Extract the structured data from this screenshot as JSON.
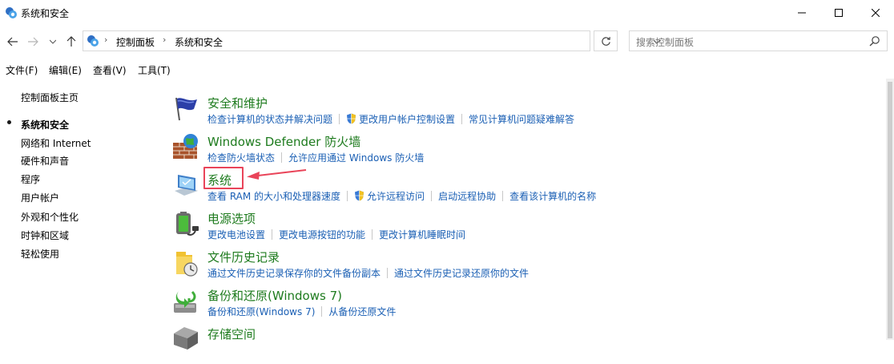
{
  "window": {
    "title": "系统和安全",
    "controls": [
      "minimize-icon",
      "maximize-icon",
      "close-icon"
    ]
  },
  "address": {
    "crumbs": [
      "控制面板",
      "系统和安全"
    ],
    "search_placeholder": "搜索控制面板"
  },
  "menu": [
    "文件(F)",
    "编辑(E)",
    "查看(V)",
    "工具(T)"
  ],
  "sidebar": {
    "items": [
      {
        "label": "控制面板主页",
        "current": false
      },
      {
        "label": "系统和安全",
        "current": true
      },
      {
        "label": "网络和 Internet",
        "current": false
      },
      {
        "label": "硬件和声音",
        "current": false
      },
      {
        "label": "程序",
        "current": false
      },
      {
        "label": "用户帐户",
        "current": false
      },
      {
        "label": "外观和个性化",
        "current": false
      },
      {
        "label": "时钟和区域",
        "current": false
      },
      {
        "label": "轻松使用",
        "current": false
      }
    ]
  },
  "categories": [
    {
      "title": "安全和维护",
      "icon": "security-flag-icon",
      "links": [
        {
          "label": "检查计算机的状态并解决问题",
          "shield": false
        },
        {
          "label": "更改用户帐户控制设置",
          "shield": true
        },
        {
          "label": "常见计算机问题疑难解答",
          "shield": false
        }
      ]
    },
    {
      "title": "Windows Defender 防火墙",
      "icon": "firewall-icon",
      "links": [
        {
          "label": "检查防火墙状态",
          "shield": false
        },
        {
          "label": "允许应用通过 Windows 防火墙",
          "shield": false
        }
      ]
    },
    {
      "title": "系统",
      "icon": "system-monitor-icon",
      "links": [
        {
          "label": "查看 RAM 的大小和处理器速度",
          "shield": false
        },
        {
          "label": "允许远程访问",
          "shield": true
        },
        {
          "label": "启动远程协助",
          "shield": false
        },
        {
          "label": "查看该计算机的名称",
          "shield": false
        }
      ]
    },
    {
      "title": "电源选项",
      "icon": "power-battery-icon",
      "links": [
        {
          "label": "更改电池设置",
          "shield": false
        },
        {
          "label": "更改电源按钮的功能",
          "shield": false
        },
        {
          "label": "更改计算机睡眠时间",
          "shield": false
        }
      ]
    },
    {
      "title": "文件历史记录",
      "icon": "file-history-icon",
      "links": [
        {
          "label": "通过文件历史记录保存你的文件备份副本",
          "shield": false
        },
        {
          "label": "通过文件历史记录还原你的文件",
          "shield": false
        }
      ]
    },
    {
      "title": "备份和还原(Windows 7)",
      "icon": "backup-restore-icon",
      "links": [
        {
          "label": "备份和还原(Windows 7)",
          "shield": false
        },
        {
          "label": "从备份还原文件",
          "shield": false
        }
      ]
    },
    {
      "title": "存储空间",
      "icon": "storage-spaces-icon",
      "links": []
    }
  ],
  "colors": {
    "category_title": "#1e7b1e",
    "link": "#1a5fb4",
    "annotation": "#e94459"
  }
}
